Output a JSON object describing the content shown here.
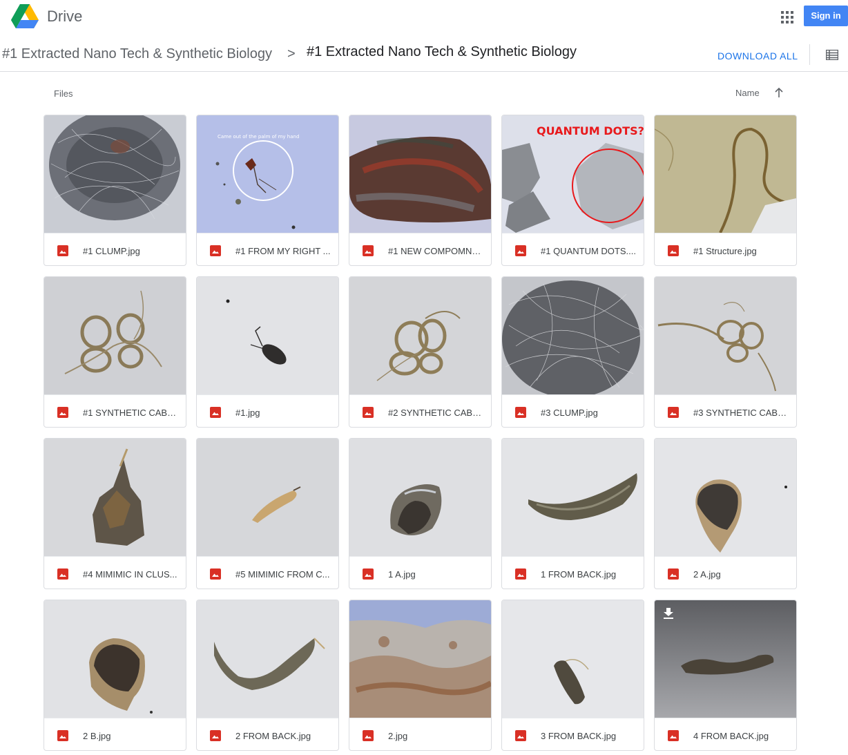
{
  "app": {
    "name": "Drive",
    "sign_in_label": "Sign in"
  },
  "breadcrumb": {
    "parent": "#1 Extracted Nano Tech & Synthetic Biology",
    "separator": ">",
    "current": "#1 Extracted Nano Tech & Synthetic Biology"
  },
  "toolbar": {
    "download_all_label": "DOWNLOAD ALL"
  },
  "files_header": {
    "label": "Files",
    "sort_label": "Name"
  },
  "files": [
    {
      "name": "#1 CLUMP.jpg"
    },
    {
      "name": "#1 FROM MY RIGHT ...",
      "thumb_text": "Came out of the palm of my hand"
    },
    {
      "name": "#1 NEW COMPOMNA..."
    },
    {
      "name": "#1 QUANTUM DOTS....",
      "thumb_text": "QUANTUM DOTS?"
    },
    {
      "name": "#1 Structure.jpg"
    },
    {
      "name": "#1 SYNTHETIC CABL..."
    },
    {
      "name": "#1.jpg"
    },
    {
      "name": "#2 SYNTHETIC CABL..."
    },
    {
      "name": "#3 CLUMP.jpg"
    },
    {
      "name": "#3 SYNTHETIC CABL..."
    },
    {
      "name": "#4 MIMIMIC IN CLUS..."
    },
    {
      "name": "#5 MIMIMIC FROM C..."
    },
    {
      "name": "1 A.jpg"
    },
    {
      "name": "1 FROM BACK.jpg"
    },
    {
      "name": "2 A.jpg"
    },
    {
      "name": "2 B.jpg"
    },
    {
      "name": "2 FROM BACK.jpg"
    },
    {
      "name": "2.jpg"
    },
    {
      "name": "3 FROM BACK.jpg"
    },
    {
      "name": "4 FROM BACK.jpg"
    }
  ],
  "icons": {
    "logo": "drive-logo",
    "apps": "apps-grid-icon",
    "view": "list-view-icon",
    "sort": "arrow-up-icon",
    "file_type": "image-file-icon",
    "download": "download-icon"
  },
  "colors": {
    "accent": "#4285f4",
    "link": "#1a73e8",
    "image_icon": "#d93025"
  }
}
